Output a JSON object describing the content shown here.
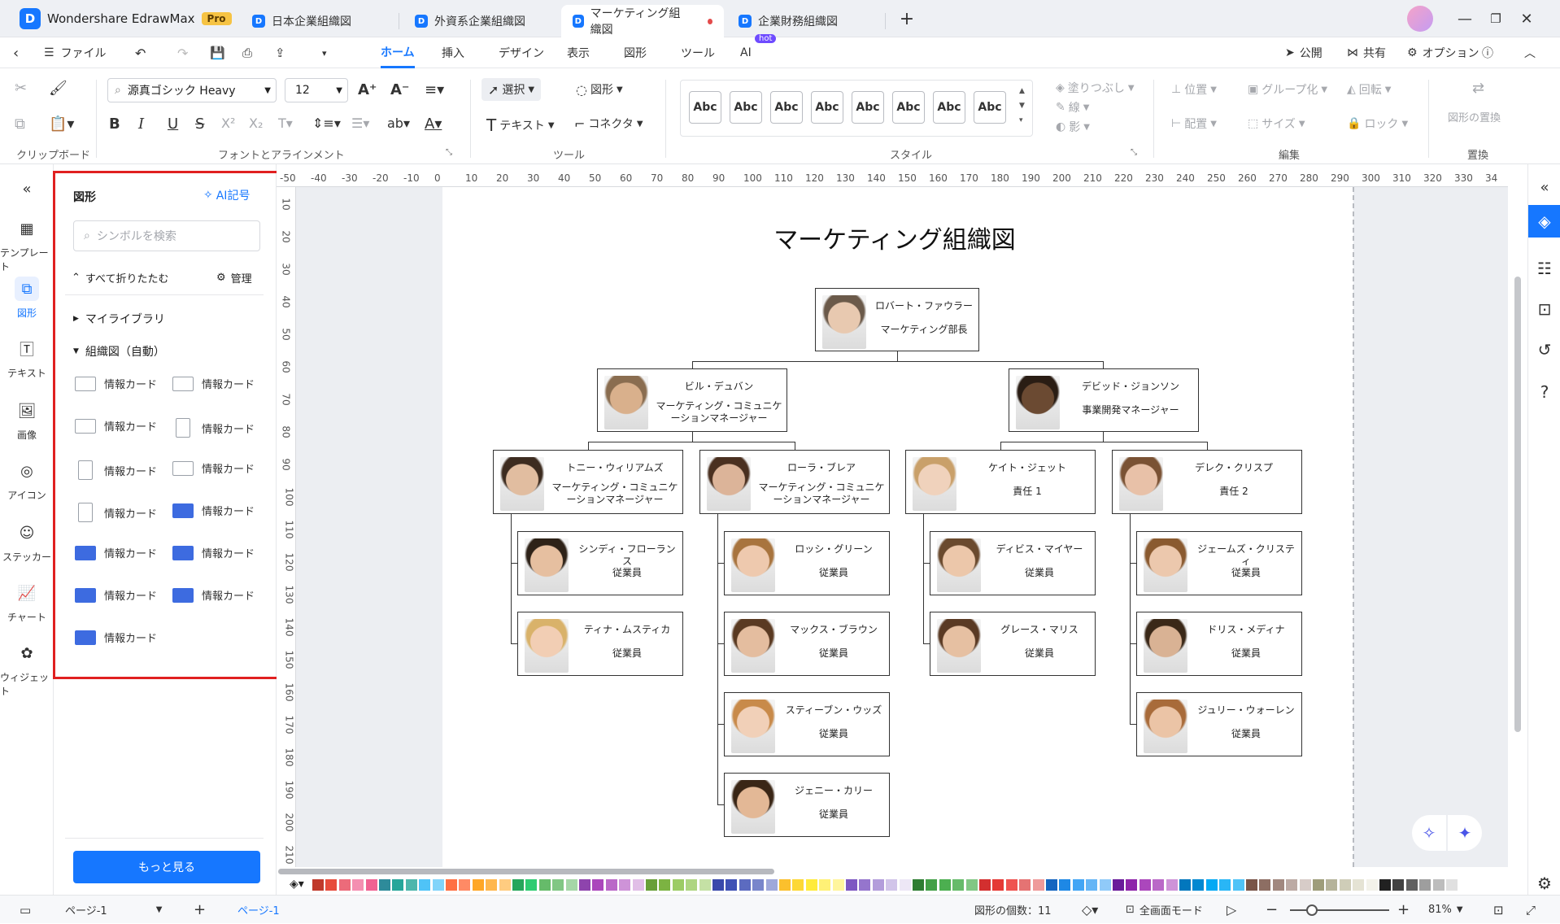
{
  "app": {
    "name": "Wondershare EdrawMax",
    "badge": "Pro"
  },
  "tabs": [
    {
      "label": "日本企業組織図"
    },
    {
      "label": "外資系企業組織図"
    },
    {
      "label": "マーケティング組織図"
    },
    {
      "label": "企業財務組織図"
    }
  ],
  "menu": {
    "file": "ファイル",
    "items": [
      "ホーム",
      "挿入",
      "デザイン",
      "表示",
      "図形",
      "ツール",
      "AI"
    ],
    "hot": "hot",
    "publish": "公開",
    "share": "共有",
    "options": "オプション"
  },
  "ribbon": {
    "font": "源真ゴシック Heavy",
    "size": "12",
    "select": "選択",
    "shape": "図形",
    "text": "テキスト",
    "connector": "コネクタ",
    "style_sample": "Abc",
    "fill": "塗りつぶし",
    "line": "線",
    "shadow": "影",
    "position": "位置",
    "align": "配置",
    "group": "グループ化",
    "size_btn": "サイズ",
    "rotate": "回転",
    "lock": "ロック",
    "replace": "図形の置換",
    "groups": {
      "clipboard": "クリップボード",
      "font": "フォントとアラインメント",
      "tools": "ツール",
      "style": "スタイル",
      "edit": "編集",
      "replace": "置換"
    }
  },
  "leftnav": [
    {
      "label": "テンプレート",
      "icon": "template-icon"
    },
    {
      "label": "図形",
      "icon": "shapes-icon"
    },
    {
      "label": "テキスト",
      "icon": "text-icon"
    },
    {
      "label": "画像",
      "icon": "image-icon"
    },
    {
      "label": "アイコン",
      "icon": "icon-library-icon"
    },
    {
      "label": "ステッカー",
      "icon": "sticker-icon"
    },
    {
      "label": "チャート",
      "icon": "chart-icon"
    },
    {
      "label": "ウィジェット",
      "icon": "widget-icon"
    }
  ],
  "panel": {
    "title": "図形",
    "ai_symbol": "AI記号",
    "search_placeholder": "シンボルを検索",
    "collapse_all": "すべて折りたたむ",
    "manage": "管理",
    "my_library": "マイライブラリ",
    "org_auto": "組織図（自動）",
    "shape_label": "情報カード",
    "more": "もっと見る"
  },
  "ruler": {
    "h": [
      "-50",
      "-40",
      "-30",
      "-20",
      "-10",
      "0",
      "10",
      "20",
      "30",
      "40",
      "50",
      "60",
      "70",
      "80",
      "90",
      "100",
      "110",
      "120",
      "130",
      "140",
      "150",
      "160",
      "170",
      "180",
      "190",
      "200",
      "210",
      "220",
      "230",
      "240",
      "250",
      "260",
      "270",
      "280",
      "290",
      "300",
      "310",
      "320",
      "330",
      "34"
    ],
    "v": [
      "10",
      "20",
      "30",
      "40",
      "50",
      "60",
      "70",
      "80",
      "90",
      "100",
      "110",
      "120",
      "130",
      "140",
      "150",
      "160",
      "170",
      "180",
      "190",
      "200",
      "210"
    ]
  },
  "chart": {
    "title": "マーケティング組織図",
    "ceo": {
      "name": "ロバート・ファウラー",
      "role": "マーケティング部長"
    },
    "managers": [
      {
        "name": "ビル・デュバン",
        "role": "マーケティング・コミュニケーションマネージャー"
      },
      {
        "name": "デビッド・ジョンソン",
        "role": "事業開発マネージャー"
      }
    ],
    "leads": [
      {
        "name": "トニー・ウィリアムズ",
        "role": "マーケティング・コミュニケーションマネージャー"
      },
      {
        "name": "ローラ・ブレア",
        "role": "マーケティング・コミュニケーションマネージャー"
      },
      {
        "name": "ケイト・ジェット",
        "role": "責任 1"
      },
      {
        "name": "デレク・クリスプ",
        "role": "責任 2"
      }
    ],
    "staff": [
      {
        "name": "シンディ・フローランス",
        "role": "従業員"
      },
      {
        "name": "ティナ・ムスティカ",
        "role": "従業員"
      },
      {
        "name": "ロッシ・グリーン",
        "role": "従業員"
      },
      {
        "name": "マックス・ブラウン",
        "role": "従業員"
      },
      {
        "name": "スティーブン・ウッズ",
        "role": "従業員"
      },
      {
        "name": "ジェニー・カリー",
        "role": "従業員"
      },
      {
        "name": "ディビス・マイヤー",
        "role": "従業員"
      },
      {
        "name": "グレース・マリス",
        "role": "従業員"
      },
      {
        "name": "ジェームズ・クリスティ",
        "role": "従業員"
      },
      {
        "name": "ドリス・メディナ",
        "role": "従業員"
      },
      {
        "name": "ジュリー・ウォーレン",
        "role": "従業員"
      }
    ]
  },
  "status": {
    "page_select": "ページ-1",
    "page_tab": "ページ-1",
    "shape_count": "図形の個数：11",
    "fullscreen": "全画面モード",
    "zoom": "81%"
  },
  "colors": {
    "accent": "#1677ff",
    "highlight": "#e02020"
  }
}
